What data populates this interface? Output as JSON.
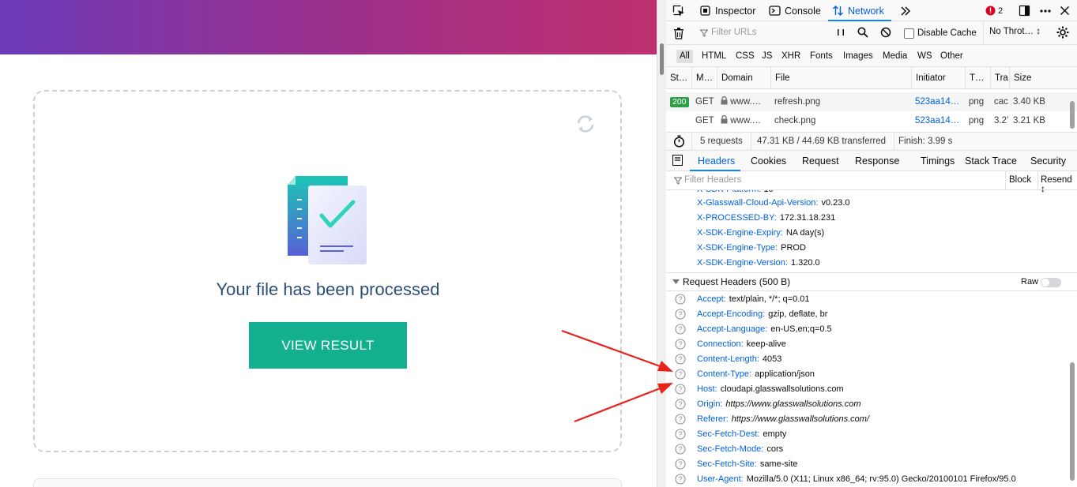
{
  "page": {
    "processed_text": "Your file has been processed",
    "view_button": "VIEW RESULT"
  },
  "devtools": {
    "toolbar": {
      "inspector": "Inspector",
      "console": "Console",
      "network": "Network",
      "error_count": "2"
    },
    "filterbar": {
      "filter_placeholder": "Filter URLs",
      "disable_cache": "Disable Cache",
      "throttle": "No Throt… ↕"
    },
    "types": [
      "All",
      "HTML",
      "CSS",
      "JS",
      "XHR",
      "Fonts",
      "Images",
      "Media",
      "WS",
      "Other"
    ],
    "columns": [
      "St…",
      "M…",
      "Domain",
      "File",
      "Initiator",
      "T…",
      "Tra",
      "Size"
    ],
    "requests": [
      {
        "status": "200",
        "method": "GET",
        "domain": "www.…",
        "file": "refresh.png",
        "initiator": "523aa14…",
        "type": "png",
        "transferred": "cac",
        "size": "3.40 KB"
      },
      {
        "status": "",
        "method": "GET",
        "domain": "www.…",
        "file": "check.png",
        "initiator": "523aa14…",
        "type": "png",
        "transferred": "3.2’",
        "size": "3.21 KB"
      }
    ],
    "summary": {
      "requests": "5 requests",
      "transferred": "47.31 KB / 44.69 KB transferred",
      "finish": "Finish: 3.99 s"
    },
    "subtabs": [
      "Headers",
      "Cookies",
      "Request",
      "Response",
      "Timings",
      "Stack Trace",
      "Security"
    ],
    "header_filter_placeholder": "Filter Headers",
    "block_label": "Block",
    "resend_label": "Resend ↕",
    "response_headers_tail": [
      {
        "name": "X-Glasswall-Cloud-Api-Version:",
        "value": "v0.23.0"
      },
      {
        "name": "X-PROCESSED-BY:",
        "value": "172.31.18.231"
      },
      {
        "name": "X-SDK-Engine-Expiry:",
        "value": "NA day(s)"
      },
      {
        "name": "X-SDK-Engine-Type:",
        "value": "PROD"
      },
      {
        "name": "X-SDK-Engine-Version:",
        "value": "1.320.0"
      }
    ],
    "request_section_title": "Request Headers (500 B)",
    "raw_label": "Raw",
    "request_headers": [
      {
        "name": "Accept:",
        "value": "text/plain, */*; q=0.01"
      },
      {
        "name": "Accept-Encoding:",
        "value": "gzip, deflate, br"
      },
      {
        "name": "Accept-Language:",
        "value": "en-US,en;q=0.5"
      },
      {
        "name": "Connection:",
        "value": "keep-alive"
      },
      {
        "name": "Content-Length:",
        "value": "4053"
      },
      {
        "name": "Content-Type:",
        "value": "application/json"
      },
      {
        "name": "Host:",
        "value": "cloudapi.glasswallsolutions.com"
      },
      {
        "name": "Origin:",
        "value": "https://www.glasswallsolutions.com"
      },
      {
        "name": "Referer:",
        "value": "https://www.glasswallsolutions.com/"
      },
      {
        "name": "Sec-Fetch-Dest:",
        "value": "empty"
      },
      {
        "name": "Sec-Fetch-Mode:",
        "value": "cors"
      },
      {
        "name": "Sec-Fetch-Site:",
        "value": "same-site"
      },
      {
        "name": "User-Agent:",
        "value": "Mozilla/5.0 (X11; Linux x86_64; rv:95.0) Gecko/20100101 Firefox/95.0"
      }
    ]
  },
  "colors": {
    "accent_button": "#12b08f",
    "banner_start": "#6b3ab8",
    "banner_end": "#c0306f",
    "devtools_link": "#0060df",
    "status_ok": "#2fa04a",
    "arrow": "#e8231a"
  }
}
